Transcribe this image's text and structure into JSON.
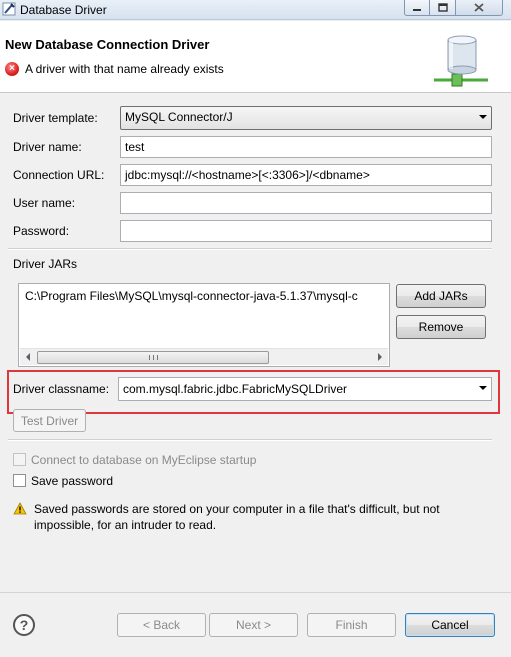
{
  "window": {
    "title": "Database Driver"
  },
  "banner": {
    "title": "New Database Connection Driver",
    "error": "A driver with that name already exists"
  },
  "form": {
    "driver_template_label": "Driver template:",
    "driver_template_value": "MySQL Connector/J",
    "driver_name_label": "Driver name:",
    "driver_name_value": "test",
    "connection_url_label": "Connection URL:",
    "connection_url_value": "jdbc:mysql://<hostname>[<:3306>]/<dbname>",
    "user_name_label": "User name:",
    "user_name_value": "",
    "password_label": "Password:",
    "password_value": ""
  },
  "jars": {
    "section_label": "Driver JARs",
    "items": [
      "C:\\Program Files\\MySQL\\mysql-connector-java-5.1.37\\mysql-c"
    ],
    "add_button": "Add JARs",
    "remove_button": "Remove"
  },
  "classname": {
    "label": "Driver classname:",
    "value": "com.mysql.fabric.jdbc.FabricMySQLDriver",
    "test_button": "Test Driver"
  },
  "options": {
    "connect_on_startup": "Connect to database on MyEclipse startup",
    "save_password": "Save password",
    "warning": "Saved passwords are stored on your computer in a file that's difficult, but not impossible, for an intruder to read."
  },
  "footer": {
    "back": "< Back",
    "next": "Next >",
    "finish": "Finish",
    "cancel": "Cancel"
  }
}
